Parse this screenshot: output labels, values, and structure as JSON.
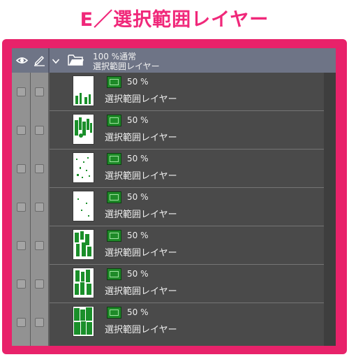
{
  "caption": "E／選択範囲レイヤー",
  "colors": {
    "caption": "#f0287a",
    "frame": "#e8226a",
    "panel_bg": "#4a4a4a",
    "header_bg": "#6e7486",
    "swatch": "#1e8a28"
  },
  "header": {
    "icons": [
      "eye-icon",
      "pen-icon",
      "chevron-down-icon",
      "folder-icon"
    ],
    "opacity_mode": "100 %通常",
    "folder_name": "選択範囲レイヤー"
  },
  "layers": [
    {
      "opacity": "50 %",
      "name": "選択範囲レイヤー",
      "thumb": 1
    },
    {
      "opacity": "50 %",
      "name": "選択範囲レイヤー",
      "thumb": 2
    },
    {
      "opacity": "50 %",
      "name": "選択範囲レイヤー",
      "thumb": 3
    },
    {
      "opacity": "50 %",
      "name": "選択範囲レイヤー",
      "thumb": 4
    },
    {
      "opacity": "50 %",
      "name": "選択範囲レイヤー",
      "thumb": 5
    },
    {
      "opacity": "50 %",
      "name": "選択範囲レイヤー",
      "thumb": 6
    },
    {
      "opacity": "50 %",
      "name": "選択範囲レイヤー",
      "thumb": 7
    }
  ]
}
